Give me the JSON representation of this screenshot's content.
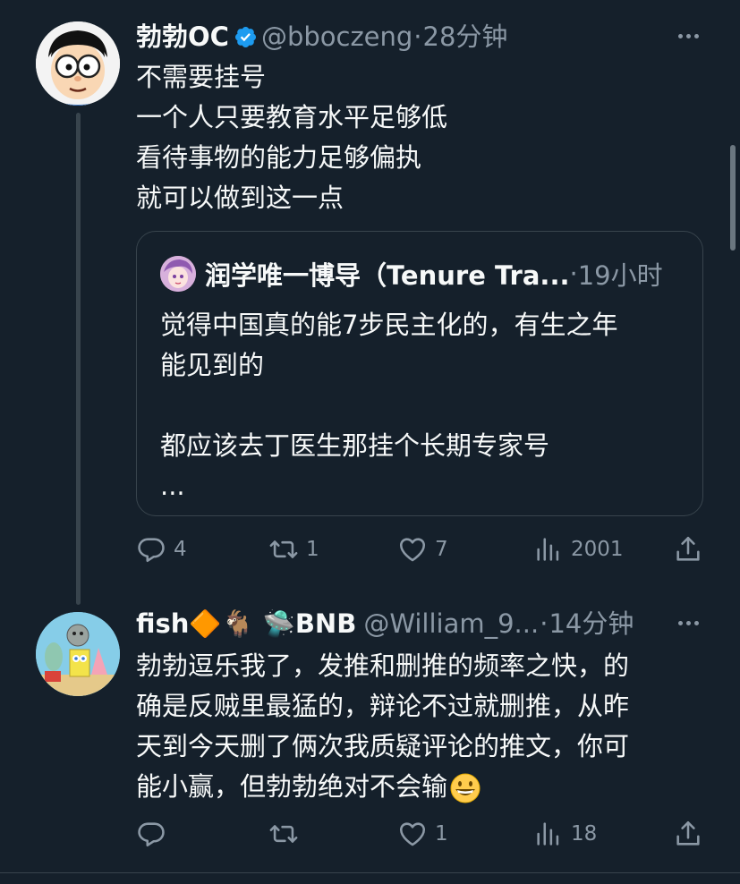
{
  "tweet1": {
    "display_name": "勃勃OC",
    "handle": "@bboczeng",
    "separator": "·",
    "time": "28分钟",
    "body_lines": [
      "不需要挂号",
      "一个人只要教育水平足够低",
      "看待事物的能力足够偏执",
      "就可以做到这一点"
    ],
    "quote": {
      "display_name": "润学唯一博导（Tenure Tra...",
      "separator": "·",
      "time": "19小时",
      "body_lines": [
        "觉得中国真的能7步民主化的，有生之年",
        "能见到的",
        "",
        "都应该去丁医生那挂个长期专家号",
        "..."
      ]
    },
    "actions": {
      "replies": "4",
      "retweets": "1",
      "likes": "7",
      "views": "2001"
    }
  },
  "tweet2": {
    "display_name": "fish🔶🐐 🛸BNB",
    "handle": "@William_9...",
    "separator": "·",
    "time": "14分钟",
    "body_lines": [
      "勃勃逗乐我了，发推和删推的频率之快，的",
      "确是反贼里最猛的，辩论不过就删推，从昨",
      "天到今天删了俩次我质疑评论的推文，你可",
      "能小赢，但勃勃绝对不会输"
    ],
    "actions": {
      "replies": "",
      "retweets": "",
      "likes": "1",
      "views": "18"
    }
  },
  "colors": {
    "background": "#15202b",
    "primary_text": "#f7f9f9",
    "secondary_text": "#8b98a5",
    "border": "#38444d",
    "verified": "#1d9bf0"
  },
  "icons": {
    "verified": "verified-badge-icon",
    "more": "more-horizontal-icon",
    "reply": "reply-icon",
    "retweet": "retweet-icon",
    "like": "heart-icon",
    "views": "views-chart-icon",
    "share": "share-icon",
    "emoji": "grinning-face-emoji"
  }
}
